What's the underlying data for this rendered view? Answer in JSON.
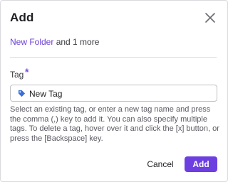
{
  "dialog": {
    "title": "Add",
    "subject": {
      "link": "New Folder",
      "rest": " and 1 more"
    },
    "field": {
      "label": "Tag",
      "required_mark": "*",
      "tag_value": "New Tag",
      "tag_icon": "tag-icon"
    },
    "help_text": "Select an existing tag, or enter a new tag name and press the comma (,) key to add it. You can also specify multiple tags. To delete a tag, hover over it and click the [x] button, or press the [Backspace] key.",
    "buttons": {
      "cancel": "Cancel",
      "add": "Add"
    },
    "colors": {
      "accent": "#6d3fe0",
      "link": "#6b3fd8",
      "tag_icon": "#3b6fd6"
    }
  }
}
